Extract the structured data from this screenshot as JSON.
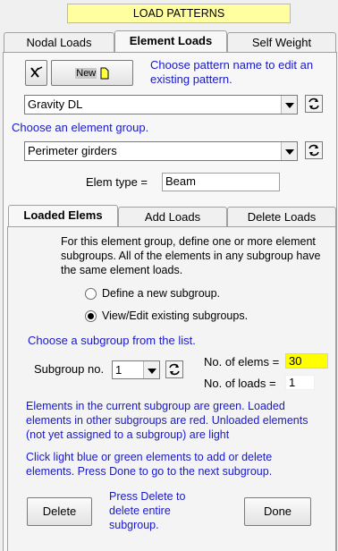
{
  "title": "LOAD PATTERNS",
  "top_tabs": [
    {
      "label": "Nodal Loads",
      "active": false
    },
    {
      "label": "Element Loads",
      "active": true
    },
    {
      "label": "Self Weight",
      "active": false
    }
  ],
  "pattern": {
    "new_label": "New",
    "hint": "Choose pattern name to edit an existing pattern.",
    "selected": "Gravity DL"
  },
  "group": {
    "prompt": "Choose an element group.",
    "selected": "Perimeter girders",
    "elem_type_label": "Elem type =",
    "elem_type_value": "Beam"
  },
  "sub_tabs": [
    {
      "label": "Loaded Elems",
      "active": true
    },
    {
      "label": "Add Loads",
      "active": false
    },
    {
      "label": "Delete Loads",
      "active": false
    }
  ],
  "loaded": {
    "intro": "For this element group, define one or more element subgroups.  All of the elements in any subgroup have the same element loads.",
    "radio_new": "Define a new subgroup.",
    "radio_edit": "View/Edit existing subgroups.",
    "choose_prompt": "Choose a subgroup from the list.",
    "subgroup_label": "Subgroup no.",
    "subgroup_value": "1",
    "num_elems_label": "No. of elems =",
    "num_elems_value": "30",
    "num_loads_label": "No. of loads =",
    "num_loads_value": "1",
    "color_info": "Elements in the current subgroup are green. Loaded elements in other subgroups are red. Unloaded elements (not yet assigned to a subgroup) are light",
    "click_info": "Click light blue or green elements to add or delete elements. Press Done to go to the next subgroup.",
    "delete_label": "Delete",
    "delete_hint": "Press Delete to delete entire subgroup.",
    "done_label": "Done"
  },
  "colors": {
    "highlight": "#ffff00",
    "hint_text": "#1818c8",
    "title_bg": "#ffffa0"
  }
}
